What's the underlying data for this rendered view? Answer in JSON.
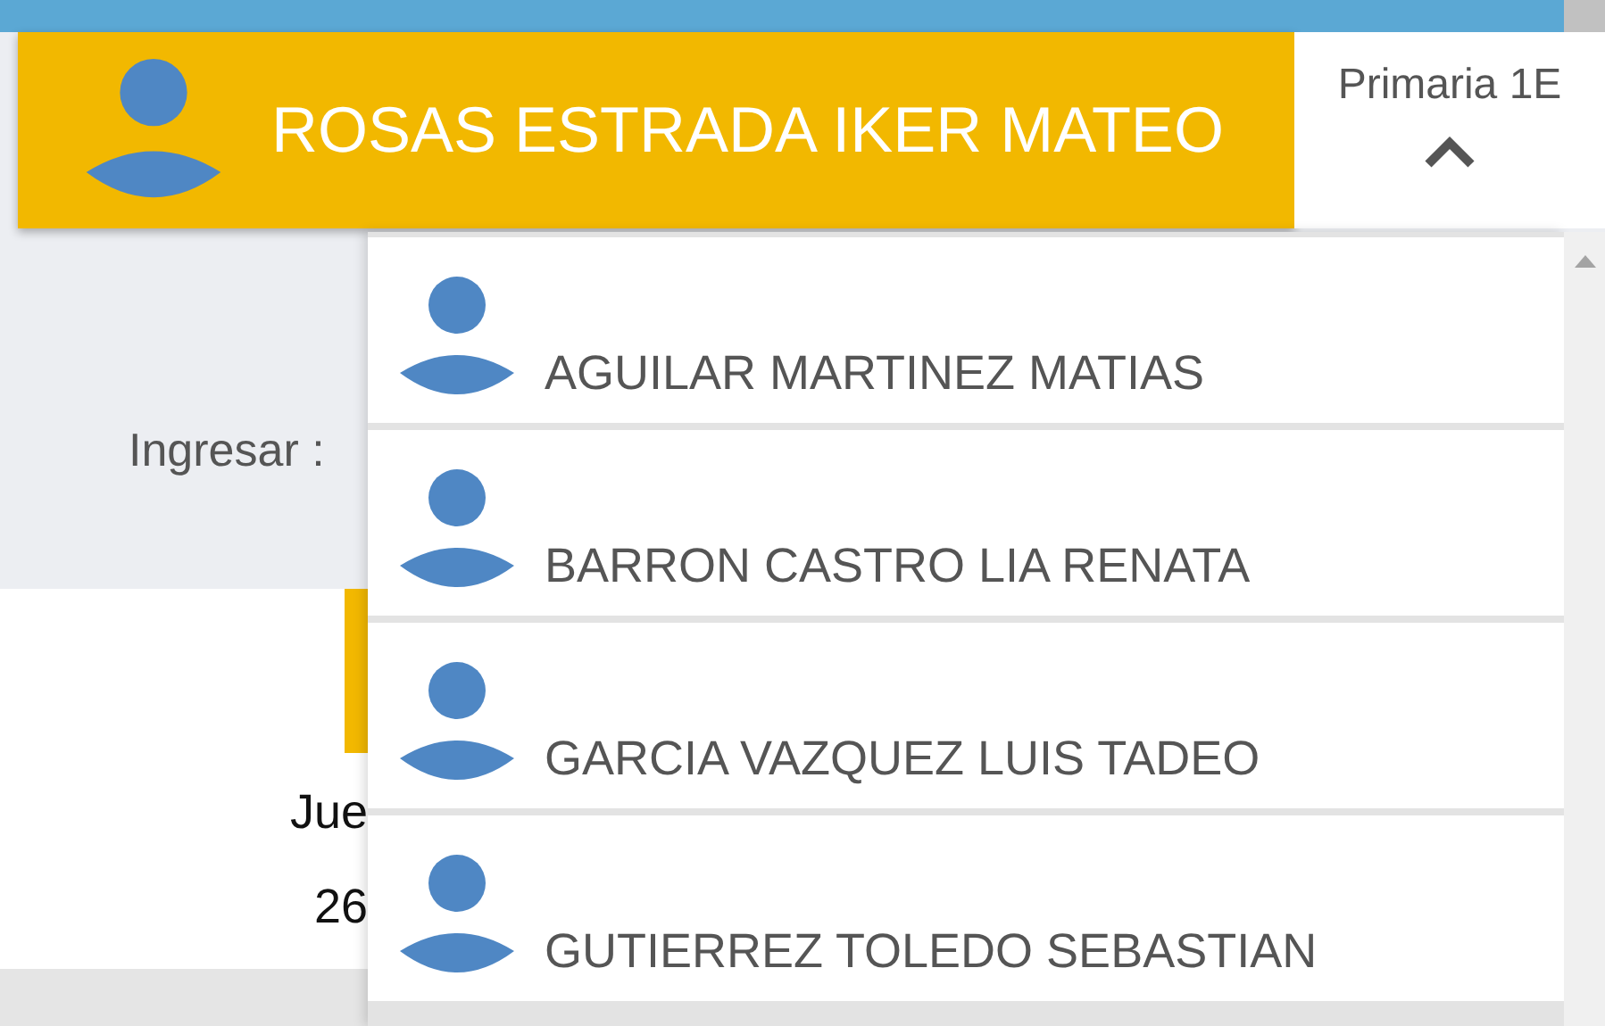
{
  "header": {
    "student": "ROSAS ESTRADA IKER MATEO",
    "group": "Primaria 1E",
    "expanded": true
  },
  "background": {
    "prompt": "Ingresar :",
    "day": "Jue",
    "date": "26"
  },
  "students": [
    {
      "name": "AGUILAR MARTINEZ MATIAS"
    },
    {
      "name": "BARRON CASTRO LIA RENATA"
    },
    {
      "name": "GARCIA VAZQUEZ LUIS TADEO"
    },
    {
      "name": "GUTIERREZ TOLEDO SEBASTIAN"
    }
  ]
}
